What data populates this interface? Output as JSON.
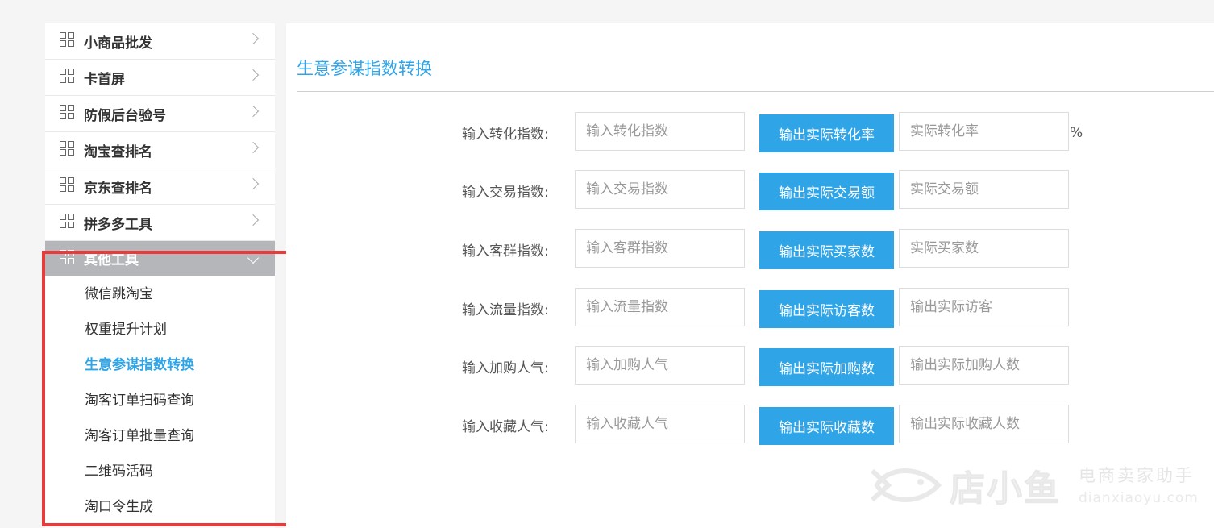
{
  "sidebar": {
    "items": [
      {
        "label": "小商品批发"
      },
      {
        "label": "卡首屏"
      },
      {
        "label": "防假后台验号"
      },
      {
        "label": "淘宝查排名"
      },
      {
        "label": "京东查排名"
      },
      {
        "label": "拼多多工具"
      }
    ],
    "active_group": {
      "label": "其他工具",
      "children": [
        {
          "label": "微信跳淘宝"
        },
        {
          "label": "权重提升计划"
        },
        {
          "label": "生意参谋指数转换"
        },
        {
          "label": "淘客订单扫码查询"
        },
        {
          "label": "淘客订单批量查询"
        },
        {
          "label": "二维码活码"
        },
        {
          "label": "淘口令生成"
        }
      ]
    }
  },
  "main": {
    "title": "生意参谋指数转换",
    "rows": [
      {
        "label": "输入转化指数:",
        "input_placeholder": "输入转化指数",
        "button": "输出实际转化率",
        "output_placeholder": "实际转化率",
        "suffix": "%"
      },
      {
        "label": "输入交易指数:",
        "input_placeholder": "输入交易指数",
        "button": "输出实际交易额",
        "output_placeholder": "实际交易额"
      },
      {
        "label": "输入客群指数:",
        "input_placeholder": "输入客群指数",
        "button": "输出实际买家数",
        "output_placeholder": "实际买家数"
      },
      {
        "label": "输入流量指数:",
        "input_placeholder": "输入流量指数",
        "button": "输出实际访客数",
        "output_placeholder": "输出实际访客"
      },
      {
        "label": "输入加购人气:",
        "input_placeholder": "输入加购人气",
        "button": "输出实际加购数",
        "output_placeholder": "输出实际加购人数"
      },
      {
        "label": "输入收藏人气:",
        "input_placeholder": "输入收藏人气",
        "button": "输出实际收藏数",
        "output_placeholder": "输出实际收藏人数"
      }
    ]
  },
  "watermark": {
    "brand": "店小鱼",
    "tagline": "电商卖家助手",
    "url": "dianxiaoyu.com"
  },
  "colors": {
    "accent": "#2fa4e7",
    "highlight_border": "#ea3a3a",
    "active_group_bg": "#b4b6ba"
  },
  "icons": {
    "nav": "grid-icon",
    "expand": "chevron-right-icon",
    "collapse": "chevron-down-icon"
  }
}
